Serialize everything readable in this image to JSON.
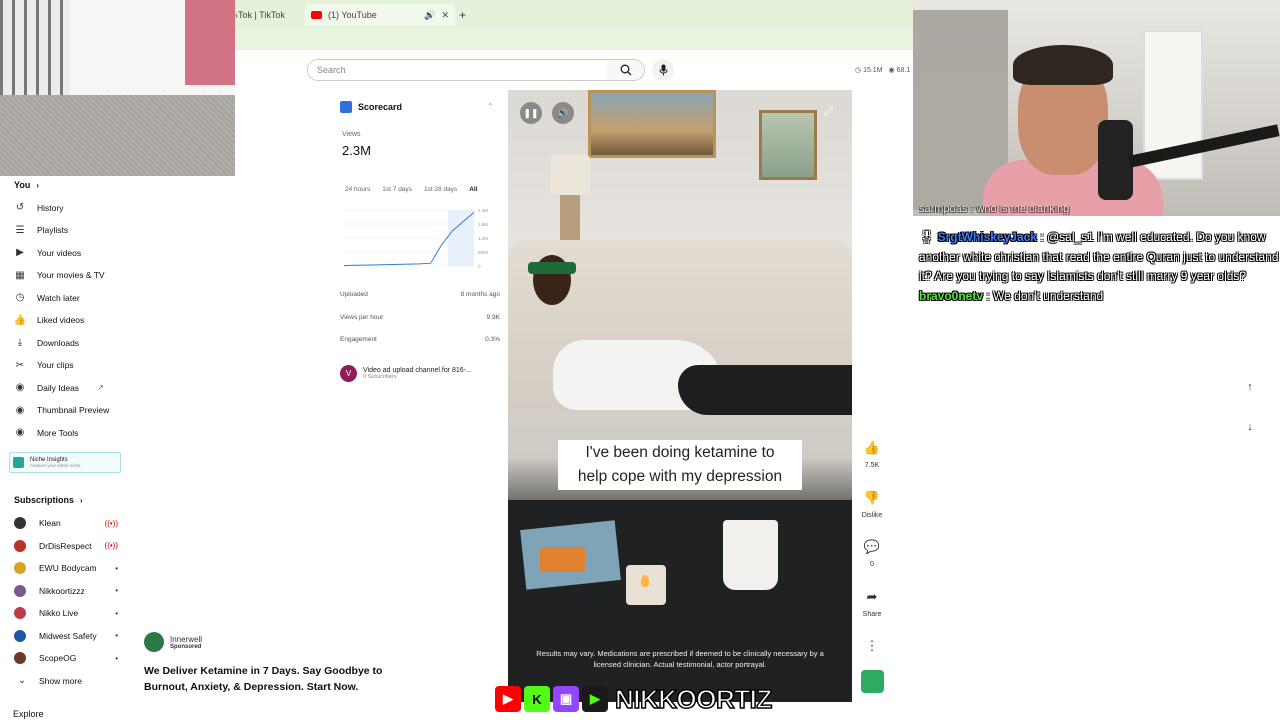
{
  "browser": {
    "tab1_label": "‹Tok | TikTok",
    "tab1_close": "✕",
    "tab2_label": "(1) YouTube",
    "tab2_close": "✕",
    "new_tab": "+"
  },
  "search": {
    "placeholder": "Search"
  },
  "top_stats": {
    "subs": "15.1M",
    "views": "68.1"
  },
  "sidebar": {
    "you_label": "You",
    "items": [
      {
        "label": "History",
        "icon": "history-icon",
        "glyph": "↺"
      },
      {
        "label": "Playlists",
        "icon": "playlists-icon",
        "glyph": "☰"
      },
      {
        "label": "Your videos",
        "icon": "your-videos-icon",
        "glyph": "▶"
      },
      {
        "label": "Your movies & TV",
        "icon": "movies-icon",
        "glyph": "▦"
      },
      {
        "label": "Watch later",
        "icon": "watch-later-icon",
        "glyph": "◷"
      },
      {
        "label": "Liked videos",
        "icon": "liked-icon",
        "glyph": "👍"
      },
      {
        "label": "Downloads",
        "icon": "downloads-icon",
        "glyph": "⤓"
      },
      {
        "label": "Your clips",
        "icon": "clips-icon",
        "glyph": "✂"
      },
      {
        "label": "Daily Ideas",
        "icon": "daily-ideas-icon",
        "glyph": "◉"
      },
      {
        "label": "Thumbnail Preview",
        "icon": "thumbnail-icon",
        "glyph": "◉"
      },
      {
        "label": "More Tools",
        "icon": "more-tools-icon",
        "glyph": "◉"
      }
    ],
    "niche_title": "Niche Insights",
    "niche_sub": "Analyze your entire niche",
    "subscriptions_label": "Subscriptions",
    "subscriptions": [
      {
        "name": "Klean",
        "status": "live",
        "color": "#333333"
      },
      {
        "name": "DrDisRespect",
        "status": "live",
        "color": "#b8322a"
      },
      {
        "name": "EWU Bodycam",
        "status": "dot",
        "color": "#d9a326"
      },
      {
        "name": "Nikkoortizzz",
        "status": "dot",
        "color": "#7a5a8a"
      },
      {
        "name": "Nikko Live",
        "status": "dot",
        "color": "#c0394b"
      },
      {
        "name": "Midwest Safety",
        "status": "dot",
        "color": "#2257a6"
      },
      {
        "name": "ScopeOG",
        "status": "dot",
        "color": "#6b3a2a"
      }
    ],
    "show_more": "Show more",
    "explore": "Explore"
  },
  "scorecard": {
    "title": "Scorecard",
    "views_label": "Views",
    "views_value": "2.3M",
    "ranges": [
      "24 hours",
      "1st 7 days",
      "1st 28 days",
      "All"
    ],
    "y_ticks": [
      "2.4M",
      "1.8M",
      "1.2M",
      "600K",
      "0"
    ],
    "uploaded_label": "Uploaded",
    "uploaded_value": "8 months ago",
    "vph_label": "Views per hour",
    "vph_value": "9.9K",
    "engagement_label": "Engagement",
    "engagement_value": "0.3%",
    "channel_initial": "V",
    "channel_name": "Video ad upload channel for 816-...",
    "channel_subs": "0 Subscribers"
  },
  "chart_data": {
    "type": "line",
    "x": [
      0,
      1,
      2,
      3,
      4,
      5,
      6,
      7,
      8,
      9,
      10,
      11,
      12
    ],
    "values": [
      0.02,
      0.03,
      0.04,
      0.05,
      0.06,
      0.07,
      0.08,
      0.09,
      0.12,
      0.9,
      1.5,
      1.9,
      2.3
    ],
    "ylim": [
      0,
      2.4
    ],
    "y_ticks": [
      "2.4M",
      "1.8M",
      "1.2M",
      "600K",
      "0"
    ],
    "xlabel": "",
    "ylabel": "",
    "title": ""
  },
  "video": {
    "caption_line1": "I've been doing ketamine to",
    "caption_line2": "help cope with my depression",
    "disclaimer": "Results may vary. Medications are prescribed if deemed to be clinically necessary by a licensed clinician. Actual testimonial, actor portrayal."
  },
  "actions": {
    "like_count": "7.5K",
    "dislike_label": "Dislike",
    "comment_count": "0",
    "share_label": "Share"
  },
  "ad": {
    "advertiser": "Innerwell",
    "sponsored": "Sponsored",
    "headline_1": "We Deliver Ketamine in 7 Days. Say Goodbye to",
    "headline_2": "Burnout, Anxiety, & Depression. Start Now."
  },
  "overlay": {
    "streamer_name": "NIKKOORTIZ"
  },
  "chat": {
    "partial_line": "sarmpoas : who is the clanking",
    "msg1_user": "SrgtWhiskeyJack",
    "msg1_text": ": @sal_s1 I'm well educated. Do you know another white christian that read the entire Quran just to understand it? Are you trying to say Islamists don't still marry 9 year olds?",
    "msg2_user": "bravo0netv",
    "msg2_text": ": We don't understand"
  }
}
